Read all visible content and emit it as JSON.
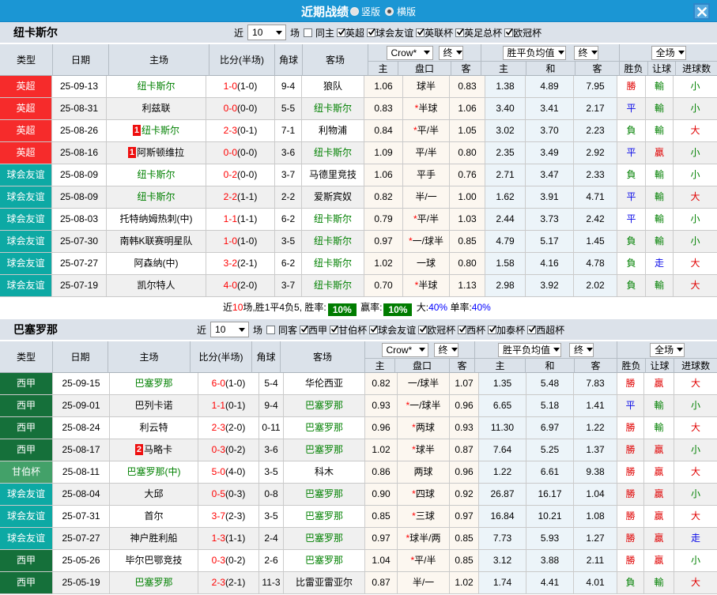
{
  "topbar": {
    "title": "近期战绩",
    "radio_vertical": "竖版",
    "radio_horizontal": "横版"
  },
  "table_header": {
    "type": "类型",
    "date": "日期",
    "home": "主场",
    "score": "比分(半场)",
    "corner": "角球",
    "away": "客场",
    "odds_home": "主",
    "odds_handicap": "盘口",
    "odds_away": "客",
    "avg_home": "主",
    "avg_draw": "和",
    "avg_away": "客",
    "res_result": "胜负",
    "res_handicap": "让球",
    "res_goals": "进球数",
    "select_bookmaker": "Crow*",
    "select_final1": "终",
    "select_avg": "胜平负均值",
    "select_final2": "终",
    "select_scope": "全场"
  },
  "league_colors": {
    "epl": "#f62b2b",
    "friendly": "#0da9a4",
    "laliga": "#15703a",
    "gamper": "#43a169"
  },
  "sections": [
    {
      "team": "纽卡斯尔",
      "filters": {
        "near": "近",
        "count": "10",
        "games": "场",
        "same_venue": "同主",
        "leagues": [
          "英超",
          "球会友谊",
          "英联杯",
          "英足总杯",
          "欧冠杯"
        ]
      },
      "rows": [
        {
          "league": "英超",
          "lk": "epl",
          "date": "25-09-13",
          "home": {
            "name": "纽卡斯尔",
            "focus": true
          },
          "ft": "1-0",
          "ht": "(1-0)",
          "corners": "9-4",
          "away": {
            "name": "狼队"
          },
          "o1": "1.06",
          "hc": {
            "star": false,
            "text": "球半"
          },
          "o2": "0.83",
          "a1": "1.38",
          "a2": "4.89",
          "a3": "7.95",
          "res": [
            [
              "勝",
              "r"
            ],
            [
              "輸",
              "g"
            ],
            [
              "小",
              "g"
            ]
          ]
        },
        {
          "league": "英超",
          "lk": "epl",
          "date": "25-08-31",
          "home": {
            "name": "利兹联"
          },
          "ft": "0-0",
          "ht": "(0-0)",
          "corners": "5-5",
          "away": {
            "name": "纽卡斯尔",
            "focus": true
          },
          "o1": "0.83",
          "hc": {
            "star": true,
            "text": "半球"
          },
          "o2": "1.06",
          "a1": "3.40",
          "a2": "3.41",
          "a3": "2.17",
          "res": [
            [
              "平",
              "b"
            ],
            [
              "輸",
              "g"
            ],
            [
              "小",
              "g"
            ]
          ]
        },
        {
          "league": "英超",
          "lk": "epl",
          "date": "25-08-26",
          "home": {
            "name": "纽卡斯尔",
            "focus": true,
            "card": "1"
          },
          "ft": "2-3",
          "ht": "(0-1)",
          "corners": "7-1",
          "away": {
            "name": "利物浦"
          },
          "o1": "0.84",
          "hc": {
            "star": true,
            "text": "平/半"
          },
          "o2": "1.05",
          "a1": "3.02",
          "a2": "3.70",
          "a3": "2.23",
          "res": [
            [
              "負",
              "g"
            ],
            [
              "輸",
              "g"
            ],
            [
              "大",
              "r"
            ]
          ]
        },
        {
          "league": "英超",
          "lk": "epl",
          "date": "25-08-16",
          "home": {
            "name": "阿斯顿维拉",
            "card": "1"
          },
          "ft": "0-0",
          "ht": "(0-0)",
          "corners": "3-6",
          "away": {
            "name": "纽卡斯尔",
            "focus": true
          },
          "o1": "1.09",
          "hc": {
            "star": false,
            "text": "平/半"
          },
          "o2": "0.80",
          "a1": "2.35",
          "a2": "3.49",
          "a3": "2.92",
          "res": [
            [
              "平",
              "b"
            ],
            [
              "贏",
              "r"
            ],
            [
              "小",
              "g"
            ]
          ]
        },
        {
          "league": "球会友谊",
          "lk": "friendly",
          "date": "25-08-09",
          "home": {
            "name": "纽卡斯尔",
            "focus": true
          },
          "ft": "0-2",
          "ht": "(0-0)",
          "corners": "3-7",
          "away": {
            "name": "马德里竞技"
          },
          "o1": "1.06",
          "hc": {
            "star": false,
            "text": "平手"
          },
          "o2": "0.76",
          "a1": "2.71",
          "a2": "3.47",
          "a3": "2.33",
          "res": [
            [
              "負",
              "g"
            ],
            [
              "輸",
              "g"
            ],
            [
              "小",
              "g"
            ]
          ]
        },
        {
          "league": "球会友谊",
          "lk": "friendly",
          "date": "25-08-09",
          "home": {
            "name": "纽卡斯尔",
            "focus": true
          },
          "ft": "2-2",
          "ht": "(1-1)",
          "corners": "2-2",
          "away": {
            "name": "爱斯宾奴"
          },
          "o1": "0.82",
          "hc": {
            "star": false,
            "text": "半/一"
          },
          "o2": "1.00",
          "a1": "1.62",
          "a2": "3.91",
          "a3": "4.71",
          "res": [
            [
              "平",
              "b"
            ],
            [
              "輸",
              "g"
            ],
            [
              "大",
              "r"
            ]
          ]
        },
        {
          "league": "球会友谊",
          "lk": "friendly",
          "date": "25-08-03",
          "home": {
            "name": "托特纳姆热刺(中)"
          },
          "ft": "1-1",
          "ht": "(1-1)",
          "corners": "6-2",
          "away": {
            "name": "纽卡斯尔",
            "focus": true
          },
          "o1": "0.79",
          "hc": {
            "star": true,
            "text": "平/半"
          },
          "o2": "1.03",
          "a1": "2.44",
          "a2": "3.73",
          "a3": "2.42",
          "res": [
            [
              "平",
              "b"
            ],
            [
              "輸",
              "g"
            ],
            [
              "小",
              "g"
            ]
          ]
        },
        {
          "league": "球会友谊",
          "lk": "friendly",
          "date": "25-07-30",
          "home": {
            "name": "南韩K联赛明星队"
          },
          "ft": "1-0",
          "ht": "(1-0)",
          "corners": "3-5",
          "away": {
            "name": "纽卡斯尔",
            "focus": true
          },
          "o1": "0.97",
          "hc": {
            "star": true,
            "text": "一/球半"
          },
          "o2": "0.85",
          "a1": "4.79",
          "a2": "5.17",
          "a3": "1.45",
          "res": [
            [
              "負",
              "g"
            ],
            [
              "輸",
              "g"
            ],
            [
              "小",
              "g"
            ]
          ]
        },
        {
          "league": "球会友谊",
          "lk": "friendly",
          "date": "25-07-27",
          "home": {
            "name": "阿森纳(中)"
          },
          "ft": "3-2",
          "ht": "(2-1)",
          "corners": "6-2",
          "away": {
            "name": "纽卡斯尔",
            "focus": true
          },
          "o1": "1.02",
          "hc": {
            "star": false,
            "text": "一球"
          },
          "o2": "0.80",
          "a1": "1.58",
          "a2": "4.16",
          "a3": "4.78",
          "res": [
            [
              "負",
              "g"
            ],
            [
              "走",
              "b"
            ],
            [
              "大",
              "r"
            ]
          ]
        },
        {
          "league": "球会友谊",
          "lk": "friendly",
          "date": "25-07-19",
          "home": {
            "name": "凯尔特人"
          },
          "ft": "4-0",
          "ht": "(2-0)",
          "corners": "3-7",
          "away": {
            "name": "纽卡斯尔",
            "focus": true
          },
          "o1": "0.70",
          "hc": {
            "star": true,
            "text": "半球"
          },
          "o2": "1.13",
          "a1": "2.98",
          "a2": "3.92",
          "a3": "2.02",
          "res": [
            [
              "負",
              "g"
            ],
            [
              "輸",
              "g"
            ],
            [
              "大",
              "r"
            ]
          ]
        }
      ],
      "summary": [
        {
          "t": "近"
        },
        {
          "t": "10",
          "cls": "red"
        },
        {
          "t": "场,胜1平4负5, 胜率:"
        },
        {
          "t": "10%",
          "badge": true
        },
        {
          "t": " 赢率:"
        },
        {
          "t": "10%",
          "badge": true
        },
        {
          "t": " 大:"
        },
        {
          "t": "40%",
          "cls": "blue"
        },
        {
          "t": " 单率:"
        },
        {
          "t": "40%",
          "cls": "blue"
        }
      ]
    },
    {
      "team": "巴塞罗那",
      "filters": {
        "near": "近",
        "count": "10",
        "games": "场",
        "same_venue": "同客",
        "leagues": [
          "西甲",
          "甘伯杯",
          "球会友谊",
          "欧冠杯",
          "西杯",
          "加泰杯",
          "西超杯"
        ]
      },
      "rows": [
        {
          "league": "西甲",
          "lk": "laliga",
          "date": "25-09-15",
          "home": {
            "name": "巴塞罗那",
            "focus": true
          },
          "ft": "6-0",
          "ht": "(1-0)",
          "corners": "5-4",
          "away": {
            "name": "华伦西亚"
          },
          "o1": "0.82",
          "hc": {
            "star": false,
            "text": "一/球半"
          },
          "o2": "1.07",
          "a1": "1.35",
          "a2": "5.48",
          "a3": "7.83",
          "res": [
            [
              "勝",
              "r"
            ],
            [
              "贏",
              "r"
            ],
            [
              "大",
              "r"
            ]
          ]
        },
        {
          "league": "西甲",
          "lk": "laliga",
          "date": "25-09-01",
          "home": {
            "name": "巴列卡诺"
          },
          "ft": "1-1",
          "ht": "(0-1)",
          "corners": "9-4",
          "away": {
            "name": "巴塞罗那",
            "focus": true
          },
          "o1": "0.93",
          "hc": {
            "star": true,
            "text": "一/球半"
          },
          "o2": "0.96",
          "a1": "6.65",
          "a2": "5.18",
          "a3": "1.41",
          "res": [
            [
              "平",
              "b"
            ],
            [
              "輸",
              "g"
            ],
            [
              "小",
              "g"
            ]
          ]
        },
        {
          "league": "西甲",
          "lk": "laliga",
          "date": "25-08-24",
          "home": {
            "name": "利云特"
          },
          "ft": "2-3",
          "ht": "(2-0)",
          "corners": "0-11",
          "away": {
            "name": "巴塞罗那",
            "focus": true
          },
          "o1": "0.96",
          "hc": {
            "star": true,
            "text": "两球"
          },
          "o2": "0.93",
          "a1": "11.30",
          "a2": "6.97",
          "a3": "1.22",
          "res": [
            [
              "勝",
              "r"
            ],
            [
              "輸",
              "g"
            ],
            [
              "大",
              "r"
            ]
          ]
        },
        {
          "league": "西甲",
          "lk": "laliga",
          "date": "25-08-17",
          "home": {
            "name": "马略卡",
            "card": "2"
          },
          "ft": "0-3",
          "ht": "(0-2)",
          "corners": "3-6",
          "away": {
            "name": "巴塞罗那",
            "focus": true
          },
          "o1": "1.02",
          "hc": {
            "star": true,
            "text": "球半"
          },
          "o2": "0.87",
          "a1": "7.64",
          "a2": "5.25",
          "a3": "1.37",
          "res": [
            [
              "勝",
              "r"
            ],
            [
              "贏",
              "r"
            ],
            [
              "小",
              "g"
            ]
          ]
        },
        {
          "league": "甘伯杯",
          "lk": "gamper",
          "date": "25-08-11",
          "home": {
            "name": "巴塞罗那(中)",
            "focus": true
          },
          "ft": "5-0",
          "ht": "(4-0)",
          "corners": "3-5",
          "away": {
            "name": "科木"
          },
          "o1": "0.86",
          "hc": {
            "star": false,
            "text": "两球"
          },
          "o2": "0.96",
          "a1": "1.22",
          "a2": "6.61",
          "a3": "9.38",
          "res": [
            [
              "勝",
              "r"
            ],
            [
              "贏",
              "r"
            ],
            [
              "大",
              "r"
            ]
          ]
        },
        {
          "league": "球会友谊",
          "lk": "friendly",
          "date": "25-08-04",
          "home": {
            "name": "大邱"
          },
          "ft": "0-5",
          "ht": "(0-3)",
          "corners": "0-8",
          "away": {
            "name": "巴塞罗那",
            "focus": true
          },
          "o1": "0.90",
          "hc": {
            "star": true,
            "text": "四球"
          },
          "o2": "0.92",
          "a1": "26.87",
          "a2": "16.17",
          "a3": "1.04",
          "res": [
            [
              "勝",
              "r"
            ],
            [
              "贏",
              "r"
            ],
            [
              "小",
              "g"
            ]
          ]
        },
        {
          "league": "球会友谊",
          "lk": "friendly",
          "date": "25-07-31",
          "home": {
            "name": "首尔"
          },
          "ft": "3-7",
          "ht": "(2-3)",
          "corners": "3-5",
          "away": {
            "name": "巴塞罗那",
            "focus": true
          },
          "o1": "0.85",
          "hc": {
            "star": true,
            "text": "三球"
          },
          "o2": "0.97",
          "a1": "16.84",
          "a2": "10.21",
          "a3": "1.08",
          "res": [
            [
              "勝",
              "r"
            ],
            [
              "贏",
              "r"
            ],
            [
              "大",
              "r"
            ]
          ]
        },
        {
          "league": "球会友谊",
          "lk": "friendly",
          "date": "25-07-27",
          "home": {
            "name": "神户胜利船"
          },
          "ft": "1-3",
          "ht": "(1-1)",
          "corners": "2-4",
          "away": {
            "name": "巴塞罗那",
            "focus": true
          },
          "o1": "0.97",
          "hc": {
            "star": true,
            "text": "球半/两"
          },
          "o2": "0.85",
          "a1": "7.73",
          "a2": "5.93",
          "a3": "1.27",
          "res": [
            [
              "勝",
              "r"
            ],
            [
              "贏",
              "r"
            ],
            [
              "走",
              "b"
            ]
          ]
        },
        {
          "league": "西甲",
          "lk": "laliga",
          "date": "25-05-26",
          "home": {
            "name": "毕尔巴鄂竞技"
          },
          "ft": "0-3",
          "ht": "(0-2)",
          "corners": "2-6",
          "away": {
            "name": "巴塞罗那",
            "focus": true
          },
          "o1": "1.04",
          "hc": {
            "star": true,
            "text": "平/半"
          },
          "o2": "0.85",
          "a1": "3.12",
          "a2": "3.88",
          "a3": "2.11",
          "res": [
            [
              "勝",
              "r"
            ],
            [
              "贏",
              "r"
            ],
            [
              "小",
              "g"
            ]
          ]
        },
        {
          "league": "西甲",
          "lk": "laliga",
          "date": "25-05-19",
          "home": {
            "name": "巴塞罗那",
            "focus": true
          },
          "ft": "2-3",
          "ht": "(2-1)",
          "corners": "11-3",
          "away": {
            "name": "比雷亚雷亚尔"
          },
          "o1": "0.87",
          "hc": {
            "star": false,
            "text": "半/一"
          },
          "o2": "1.02",
          "a1": "1.74",
          "a2": "4.41",
          "a3": "4.01",
          "res": [
            [
              "負",
              "g"
            ],
            [
              "輸",
              "g"
            ],
            [
              "大",
              "r"
            ]
          ]
        }
      ],
      "summary": []
    }
  ]
}
